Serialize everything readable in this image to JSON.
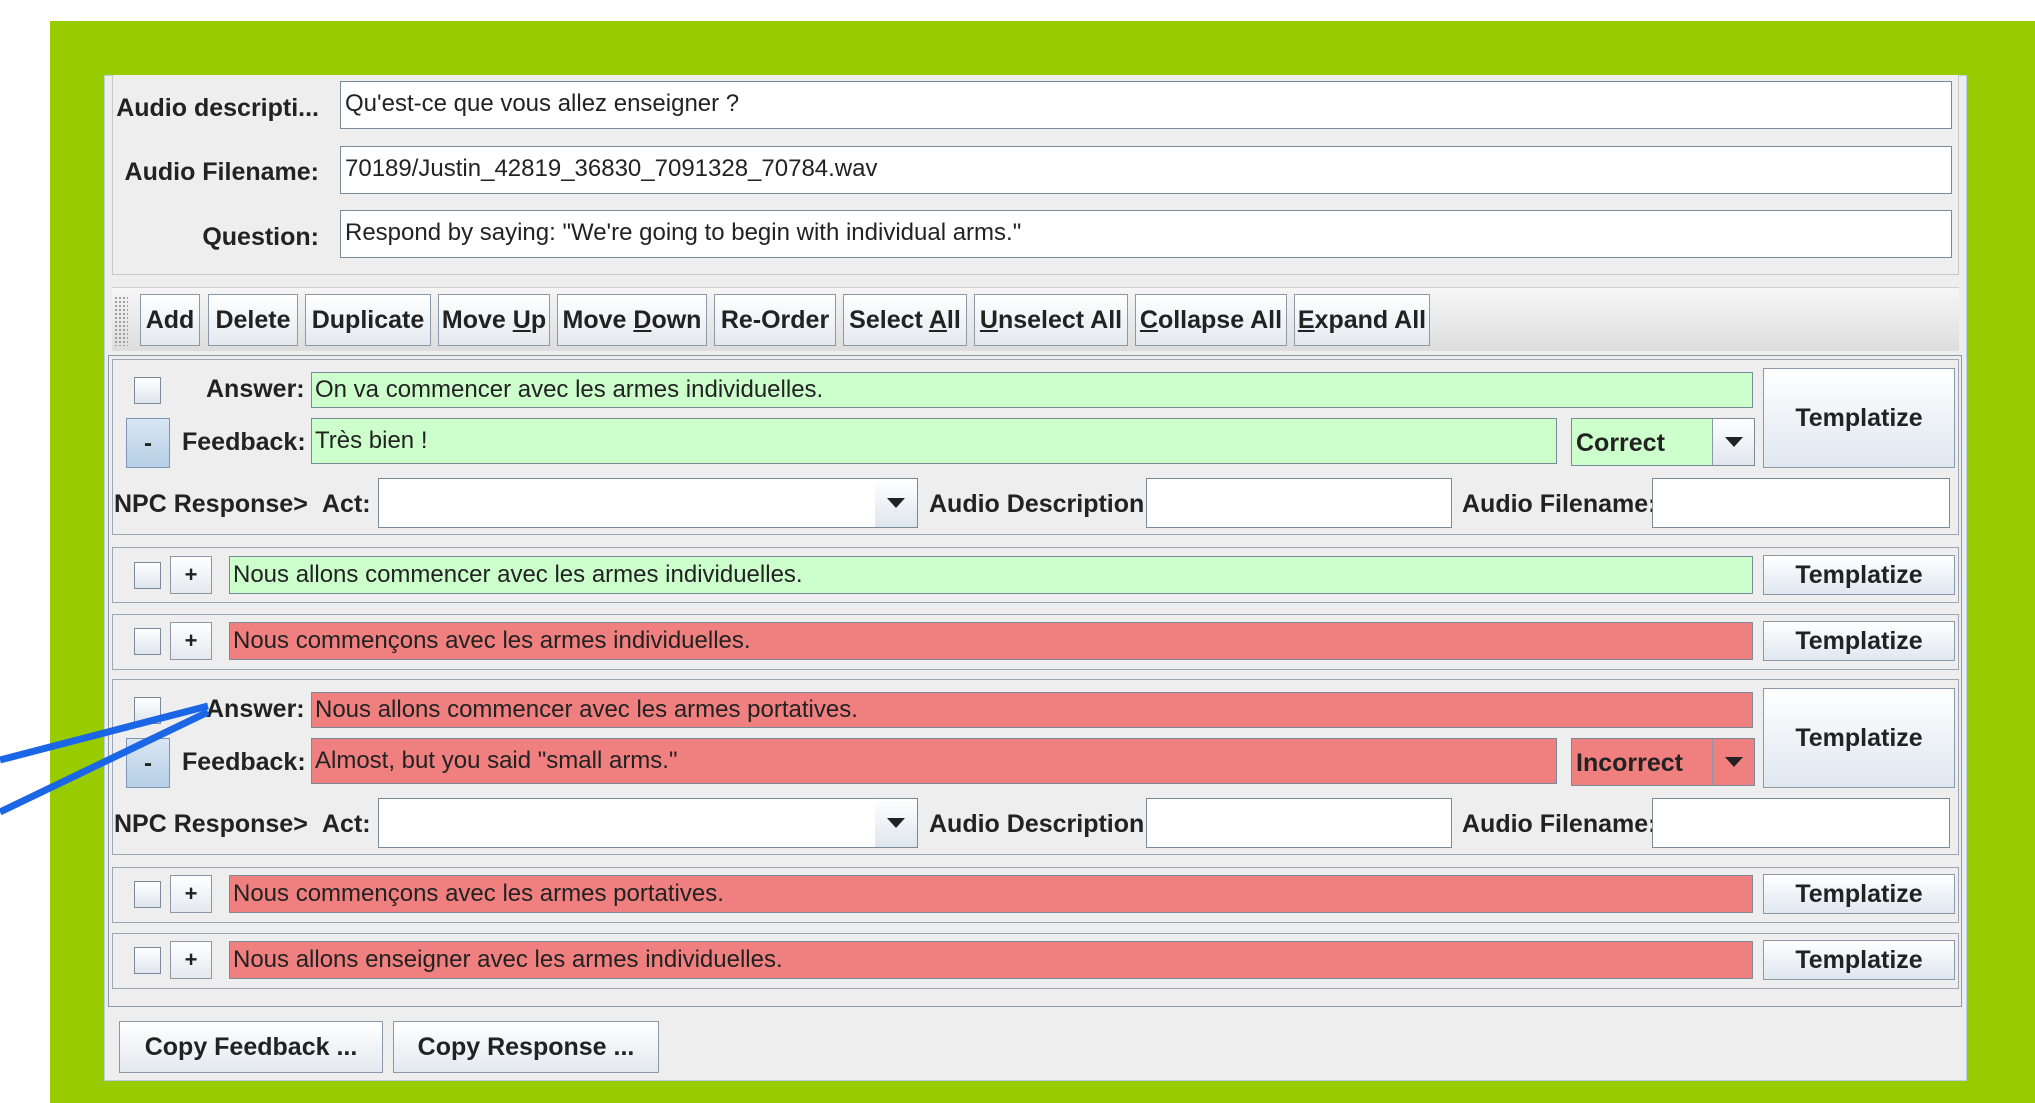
{
  "header": {
    "audio_description_label": "Audio descripti...",
    "audio_description_value": "Qu'est-ce que vous allez enseigner ?",
    "audio_filename_label": "Audio Filename:",
    "audio_filename_value": "70189/Justin_42819_36830_7091328_70784.wav",
    "question_label": "Question:",
    "question_value": "Respond by saying: \"We're going to begin with individual arms.\""
  },
  "toolbar": {
    "add": "Add",
    "delete": "Delete",
    "duplicate": "Duplicate",
    "move_up_a": "Move ",
    "move_up_u": "U",
    "move_up_b": "p",
    "move_down_a": "Move ",
    "move_down_u": "D",
    "move_down_b": "own",
    "reorder": "Re-Order",
    "select_all_a": "Select ",
    "select_all_u": "A",
    "select_all_b": "ll",
    "unselect_all_u": "U",
    "unselect_all_b": "nselect All",
    "collapse_all_u": "C",
    "collapse_all_b": "ollapse All",
    "expand_all_u": "E",
    "expand_all_b": "xpand All"
  },
  "labels": {
    "answer": "Answer:",
    "feedback": "Feedback:",
    "npc_response": "NPC Response>",
    "act": "Act:",
    "audio_description": "Audio Description:",
    "audio_filename": "Audio Filename:",
    "templatize": "Templatize",
    "plus": "+",
    "minus": "-"
  },
  "answers": [
    {
      "expanded": true,
      "status": "correct",
      "answer": "On va commencer avec les armes individuelles.",
      "feedback": "Très bien !",
      "grade": "Correct"
    },
    {
      "expanded": false,
      "status": "correct",
      "answer": "Nous allons commencer avec les armes individuelles."
    },
    {
      "expanded": false,
      "status": "incorrect",
      "answer": "Nous commençons avec les armes individuelles."
    },
    {
      "expanded": true,
      "status": "incorrect",
      "answer": "Nous allons commencer avec les armes portatives.",
      "feedback": "Almost, but you said \"small arms.\"",
      "grade": "Incorrect"
    },
    {
      "expanded": false,
      "status": "incorrect",
      "answer": "Nous commençons avec les armes portatives."
    },
    {
      "expanded": false,
      "status": "incorrect",
      "answer": "Nous allons enseigner avec les armes individuelles."
    }
  ],
  "footer": {
    "copy_feedback": "Copy Feedback ...",
    "copy_response": "Copy Response ..."
  },
  "colors": {
    "frame_green": "#99cc00",
    "correct_green": "#ccffcc",
    "incorrect_red": "#f08080",
    "annotation_arrow": "#1a66e6"
  }
}
